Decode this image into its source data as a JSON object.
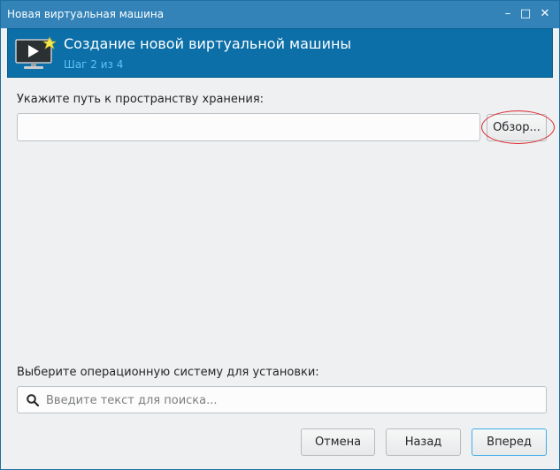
{
  "window": {
    "title": "Новая виртуальная машина",
    "controls": {
      "minimize": "–",
      "maximize": "□",
      "close": "✕"
    }
  },
  "header": {
    "title": "Создание новой виртуальной машины",
    "subtitle": "Шаг 2 из 4",
    "icon": "vm-monitor-icon"
  },
  "storage": {
    "label": "Укажите путь к пространству хранения:",
    "path_value": "",
    "browse_label": "Обзор..."
  },
  "os": {
    "label": "Выберите операционную систему для установки:",
    "search_value": "",
    "search_placeholder": "Введите текст для поиска...",
    "icon": "search-icon"
  },
  "footer": {
    "cancel_label": "Отмена",
    "back_label": "Назад",
    "next_label": "Вперед"
  },
  "colors": {
    "titlebar": "#3383b8",
    "header": "#0c6fa8",
    "subtitle": "#5fc3f5",
    "highlight": "#d9262b",
    "focus": "#3daee9"
  }
}
